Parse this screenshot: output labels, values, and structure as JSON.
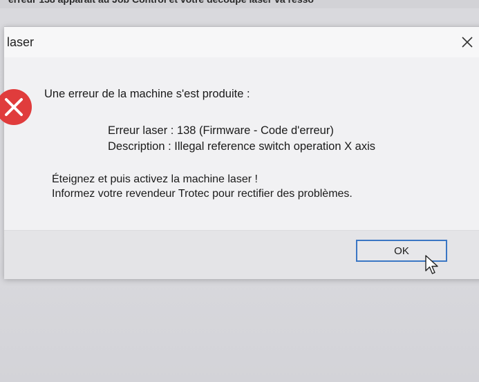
{
  "background": {
    "top_text": "erreur 138 apparaît au Job Control et votre découpe laser va resso"
  },
  "dialog": {
    "title": "laser",
    "heading": "Une erreur de la machine s'est produite :",
    "error_line": "Erreur laser : 138 (Firmware - Code d'erreur)",
    "description_line": "Description : Illegal reference switch operation X axis",
    "instruction_1": "Éteignez et puis activez la machine laser !",
    "instruction_2": "Informez votre revendeur Trotec pour rectifier des problèmes.",
    "ok_label": "OK"
  },
  "colors": {
    "error_red": "#e03c3c",
    "focus_blue": "#3a76c4"
  },
  "icons": {
    "close": "close-icon",
    "error": "error-icon",
    "pointer": "mouse-pointer-icon"
  }
}
